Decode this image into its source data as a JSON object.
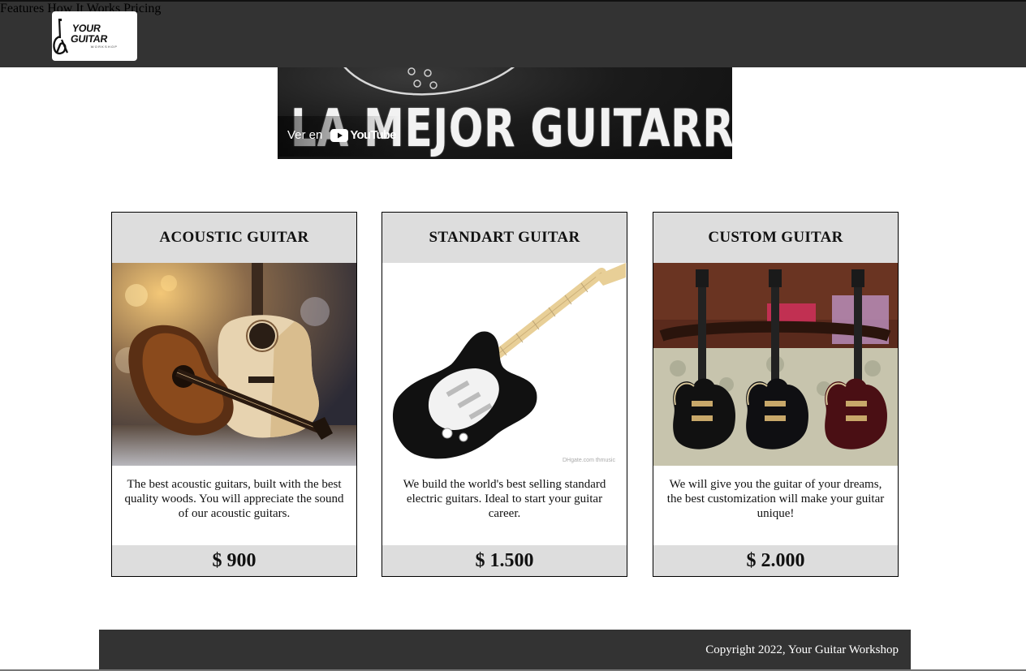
{
  "header": {
    "logo": {
      "text": "YOUR GUITAR",
      "subtext": "WORKSHOP"
    },
    "nav": [
      {
        "label": "Features"
      },
      {
        "label": "How It Works"
      },
      {
        "label": "Pricing"
      }
    ]
  },
  "video": {
    "overlay_text": "LA MEJOR GUITARRA",
    "watch_on": "Ver en",
    "youtube": "YouTube"
  },
  "cards": [
    {
      "title": "ACOUSTIC GUITAR",
      "image": "acoustic-guitars-photo",
      "description": "The best acoustic guitars, built with the best quality woods. You will appreciate the sound of our acoustic guitars.",
      "price": "$ 900"
    },
    {
      "title": "STANDART GUITAR",
      "image": "electric-guitar-photo",
      "description": "We build the world's best selling standard electric guitars. Ideal to start your guitar career.",
      "price": "$ 1.500"
    },
    {
      "title": "CUSTOM GUITAR",
      "image": "custom-guitars-photo",
      "description": "We will give you the guitar of your dreams, the best customization will make your guitar unique!",
      "price": "$ 2.000"
    }
  ],
  "footer": {
    "copyright": "Copyright 2022, Your Guitar Workshop"
  }
}
